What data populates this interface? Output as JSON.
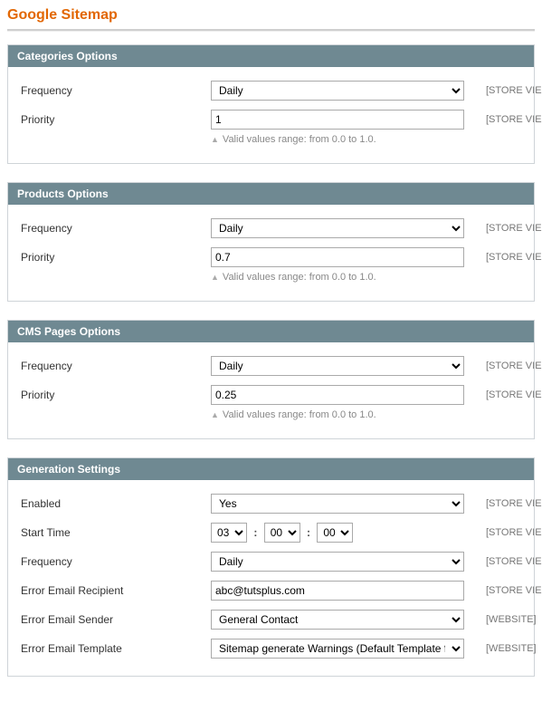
{
  "page_title": "Google Sitemap",
  "scope": {
    "store_view": "[STORE VIE",
    "website": "[WEBSITE]"
  },
  "hint_valid_range": "Valid values range: from 0.0 to 1.0.",
  "options_daily": "Daily",
  "sections": {
    "categories": {
      "title": "Categories Options",
      "frequency_label": "Frequency",
      "frequency_value": "Daily",
      "priority_label": "Priority",
      "priority_value": "1"
    },
    "products": {
      "title": "Products Options",
      "frequency_label": "Frequency",
      "frequency_value": "Daily",
      "priority_label": "Priority",
      "priority_value": "0.7"
    },
    "cms": {
      "title": "CMS Pages Options",
      "frequency_label": "Frequency",
      "frequency_value": "Daily",
      "priority_label": "Priority",
      "priority_value": "0.25"
    },
    "generation": {
      "title": "Generation Settings",
      "enabled_label": "Enabled",
      "enabled_value": "Yes",
      "start_time_label": "Start Time",
      "start_time": {
        "hh": "03",
        "mm": "00",
        "ss": "00"
      },
      "frequency_label": "Frequency",
      "frequency_value": "Daily",
      "recipient_label": "Error Email Recipient",
      "recipient_value": "abc@tutsplus.com",
      "sender_label": "Error Email Sender",
      "sender_value": "General Contact",
      "template_label": "Error Email Template",
      "template_value": "Sitemap generate Warnings (Default Template f"
    }
  }
}
